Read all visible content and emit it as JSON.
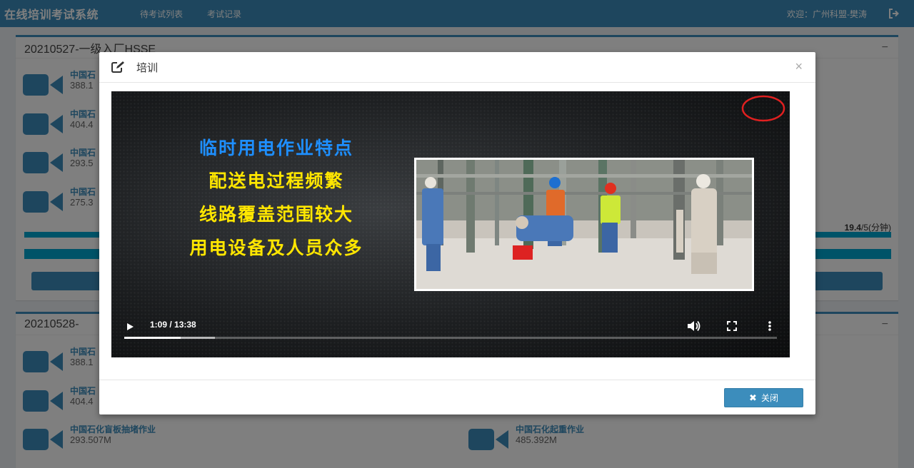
{
  "app": {
    "title": "在线培训考试系统",
    "nav": [
      "待考试列表",
      "考试记录"
    ],
    "welcome": "欢迎：广州科盟-樊涛",
    "logout_icon": "sign-out-icon"
  },
  "background": {
    "panels": [
      {
        "title": "20210527-一级入厂HSSE",
        "videos": [
          {
            "name": "中国石",
            "size": "388.1"
          },
          {
            "name": "中国石",
            "size": "404.4"
          },
          {
            "name": "中国石",
            "size": "293.5"
          },
          {
            "name": "中国石",
            "size": "275.3"
          }
        ],
        "duration_value": "19.4",
        "duration_suffix": "/5(分钟)"
      },
      {
        "title": "20210528-",
        "videos": [
          {
            "name": "中国石",
            "size": "388.1"
          },
          {
            "name": "中国石",
            "size": "404.4"
          },
          {
            "name": "中国石化盲板抽堵作业",
            "size": "293.507M"
          },
          {
            "name": "中国石化起重作业",
            "size": "485.392M"
          }
        ]
      }
    ]
  },
  "modal": {
    "title": "培训",
    "title_icon": "edit-icon",
    "close_symbol": "×",
    "video": {
      "lines": [
        {
          "text": "临时用电作业特点",
          "color": "#1e8fff"
        },
        {
          "text": "配送电过程频繁",
          "color": "#ffe600"
        },
        {
          "text": "线路覆盖范围较大",
          "color": "#ffe600"
        },
        {
          "text": "用电设备及人员众多",
          "color": "#ffe600"
        }
      ],
      "time": "1:09 / 13:38",
      "progress": 0.086,
      "buffered": 0.139
    },
    "footer_button": "关闭",
    "footer_button_icon": "close-icon"
  }
}
